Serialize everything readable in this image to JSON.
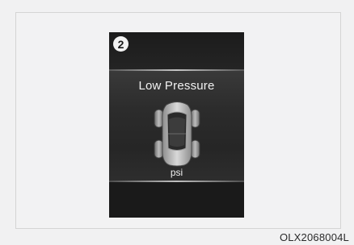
{
  "display": {
    "badge": "2",
    "title": "Low Pressure",
    "unit": "psi",
    "icon": "car-top-view-icon"
  },
  "caption": "OLX2068004L",
  "colors": {
    "display_bg": "#1a1a1a",
    "text": "#f2f2f2"
  }
}
